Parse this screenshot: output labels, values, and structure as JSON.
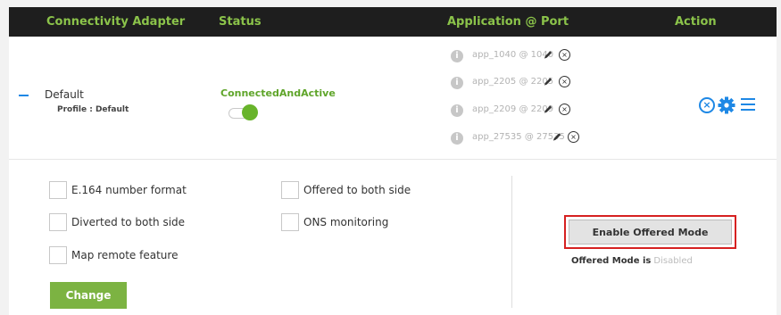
{
  "header": {
    "columns": [
      "Connectivity Adapter",
      "Status",
      "Application @ Port",
      "Action"
    ]
  },
  "adapter": {
    "name": "Default",
    "profile": "Profile : Default",
    "status": "ConnectedAndActive",
    "toggle_on": true
  },
  "applications": [
    "app_1040 @ 1040",
    "app_2205 @ 2205",
    "app_2209 @ 2209",
    "app_27535 @ 27535"
  ],
  "actions": {
    "icons": [
      "close-circle-icon",
      "gear-icon",
      "menu-icon"
    ]
  },
  "options": {
    "e164": "E.164 number format",
    "diverted": "Diverted to both side",
    "map_remote": "Map remote feature",
    "offered_both": "Offered to both side",
    "ons": "ONS monitoring",
    "change_label": "Change"
  },
  "offered_mode": {
    "button_label": "Enable Offered Mode",
    "status_label": "Offered Mode is",
    "status_value": "Disabled"
  },
  "colors": {
    "header_bg": "#1e1e1e",
    "header_text": "#8bc34a",
    "accent_blue": "#1e88e5",
    "status_green": "#5fa52a",
    "button_green": "#7cb342",
    "highlight_red": "#d62121"
  }
}
